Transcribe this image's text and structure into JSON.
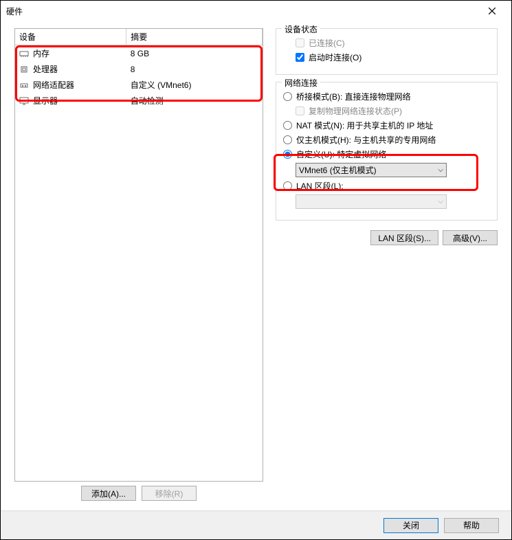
{
  "title": "硬件",
  "headers": {
    "device": "设备",
    "summary": "摘要"
  },
  "devices": [
    {
      "icon": "memory-icon",
      "name": "内存",
      "summary": "8 GB"
    },
    {
      "icon": "cpu-icon",
      "name": "处理器",
      "summary": "8"
    },
    {
      "icon": "network-icon",
      "name": "网络适配器",
      "summary": "自定义 (VMnet6)"
    },
    {
      "icon": "display-icon",
      "name": "显示器",
      "summary": "自动检测"
    }
  ],
  "buttons": {
    "add": "添加(A)...",
    "remove": "移除(R)",
    "lan_segments": "LAN 区段(S)...",
    "advanced": "高级(V)...",
    "close": "关闭",
    "help": "帮助"
  },
  "device_status": {
    "title": "设备状态",
    "connected": "已连接(C)",
    "connect_on_start": "启动时连接(O)"
  },
  "network_connection": {
    "title": "网络连接",
    "bridge": "桥接模式(B): 直接连接物理网络",
    "replicate": "复制物理网络连接状态(P)",
    "nat": "NAT 模式(N): 用于共享主机的 IP 地址",
    "hostonly": "仅主机模式(H): 与主机共享的专用网络",
    "custom": "自定义(U): 特定虚拟网络",
    "custom_value": "VMnet6 (仅主机模式)",
    "lan": "LAN 区段(L):",
    "lan_value": ""
  }
}
